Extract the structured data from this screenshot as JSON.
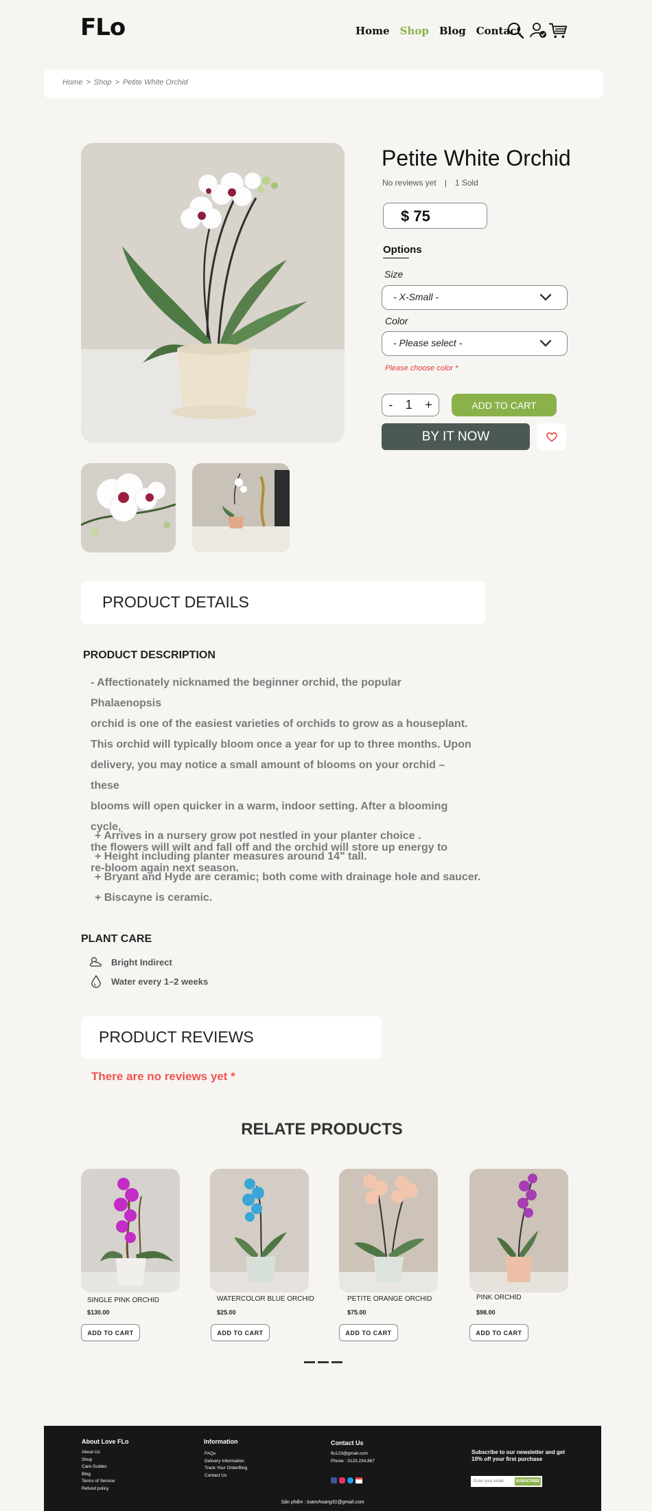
{
  "header": {
    "logo": "FLo",
    "nav": [
      "Home",
      "Shop",
      "Blog",
      "Contact"
    ],
    "active_nav": "Shop",
    "icons": [
      "search-icon",
      "user-icon",
      "cart-icon"
    ]
  },
  "breadcrumb": {
    "items": [
      "Home",
      "Shop",
      "Petite White Orchid"
    ],
    "separator": ">"
  },
  "product": {
    "title": "Petite White Orchid",
    "reviews": "No reviews yet",
    "divider": "|",
    "sold": "1 Sold",
    "price": "$ 75",
    "options_title": "Options",
    "size_label": "Size",
    "size_value": "- X-Small -",
    "color_label": "Color",
    "color_value": "- Please select -",
    "color_error": "Please choose color *",
    "qty_minus": "-",
    "qty_value": "1",
    "qty_plus": "+",
    "add_to_cart": "ADD TO CART",
    "buy_now": "BY IT NOW"
  },
  "details": {
    "section_title": "PRODUCT DETAILS",
    "description_title": "PRODUCT DESCRIPTION",
    "description_lines": [
      "- Affectionately nicknamed the beginner orchid, the popular Phalaenopsis",
      "orchid is one of the easiest varieties of orchids to grow as a houseplant.",
      "This orchid will typically bloom once a year for up to three months. Upon",
      "delivery, you may notice a small amount of blooms on your orchid – these",
      "blooms will open quicker in a warm, indoor setting. After a blooming cycle,",
      "the flowers will wilt and fall off and the orchid will store up energy to",
      "re-bloom again next season."
    ],
    "bullets": [
      "+ Arrives in a nursery grow pot nestled in your planter choice .",
      "+ Height including planter measures around 14\" tall.",
      "+ Bryant and Hyde are ceramic; both come with drainage hole and saucer.",
      "+ Biscayne is ceramic."
    ],
    "plant_care_title": "PLANT CARE",
    "care_items": [
      {
        "icon": "sun-cloud-icon",
        "text": "Bright Indirect"
      },
      {
        "icon": "water-drop-icon",
        "text": "Water every 1–2 weeks"
      }
    ]
  },
  "reviews": {
    "section_title": "PRODUCT REVIEWS",
    "empty_text": "There are no reviews yet *"
  },
  "related": {
    "title": "RELATE PRODUCTS",
    "products": [
      {
        "name": "SINGLE PINK ORCHID",
        "price": "$130.00",
        "button": "ADD TO CART"
      },
      {
        "name": "WATERCOLOR BLUE ORCHID",
        "price": "$25.00",
        "button": "ADD TO CART"
      },
      {
        "name": "PETITE ORANGE ORCHID",
        "price": "$75.00",
        "button": "ADD TO CART"
      },
      {
        "name": "PINK ORCHID",
        "price": "$98.00",
        "button": "ADD TO CART"
      }
    ]
  },
  "footer": {
    "about_title": "About Love FLo",
    "about_links": [
      "About Us",
      "Shop",
      "Care Guides",
      "Blog",
      "Terms of Service",
      "Refund policy"
    ],
    "info_title": "Information",
    "info_links": [
      "FAQs",
      "Delivery Information",
      "Track Your OrderBlog",
      "Contact Us"
    ],
    "contact_title": "Contact Us",
    "contact_email": "flo123@gmail.com",
    "contact_phone": "Phone : 0123.234.867",
    "social_icons": [
      "facebook-icon",
      "instagram-icon",
      "twitter-icon",
      "gmail-icon"
    ],
    "newsletter_text": "Subscribe to our newsletter and get 10% off your first purchase",
    "email_placeholder": "Enter your email",
    "subscribe": "SUBSCRIBE",
    "copyright": "Sản phẩm : tuanvhoang31@gmail.com"
  },
  "colors": {
    "accent": "#8ab14a",
    "buy_now": "#4c5854",
    "error": "#e53935",
    "footer": "#171717",
    "background": "#f6f5f2"
  }
}
